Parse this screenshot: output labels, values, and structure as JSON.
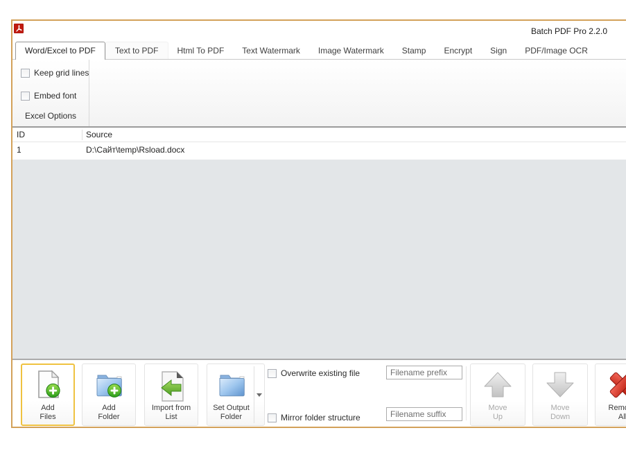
{
  "window": {
    "title": "Batch PDF Pro 2.2.0"
  },
  "tabs": [
    {
      "label": "Word/Excel to PDF",
      "active": true
    },
    {
      "label": "Text to PDF"
    },
    {
      "label": "Html To PDF"
    },
    {
      "label": "Text Watermark"
    },
    {
      "label": "Image Watermark"
    },
    {
      "label": "Stamp"
    },
    {
      "label": "Encrypt"
    },
    {
      "label": "Sign"
    },
    {
      "label": "PDF/Image OCR"
    }
  ],
  "excel_options": {
    "title": "Excel Options",
    "keep_grid_lines": {
      "label": "Keep grid lines",
      "checked": false
    },
    "embed_font": {
      "label": "Embed font",
      "checked": false
    }
  },
  "file_table": {
    "columns": {
      "id": "ID",
      "source": "Source"
    },
    "rows": [
      {
        "id": "1",
        "source": "D:\\Сайт\\temp\\Rsload.docx"
      }
    ]
  },
  "toolbar": {
    "add_files": "Add\nFiles",
    "add_folder": "Add\nFolder",
    "import_from_list": "Import from List",
    "set_output_folder": "Set Output\nFolder",
    "overwrite_existing": "Overwrite existing file",
    "mirror_structure": "Mirror folder structure",
    "filename_prefix_placeholder": "Filename prefix",
    "filename_suffix_placeholder": "Filename suffix",
    "move_up": "Move\nUp",
    "move_down": "Move\nDown",
    "remove_all": "Remove\nAll"
  },
  "colors": {
    "window_border": "#D3A159",
    "focus_border": "#EFC240",
    "add_green": "#2B9E1B",
    "folder_blue": "#7FA8D9",
    "remove_red": "#C01E10"
  }
}
